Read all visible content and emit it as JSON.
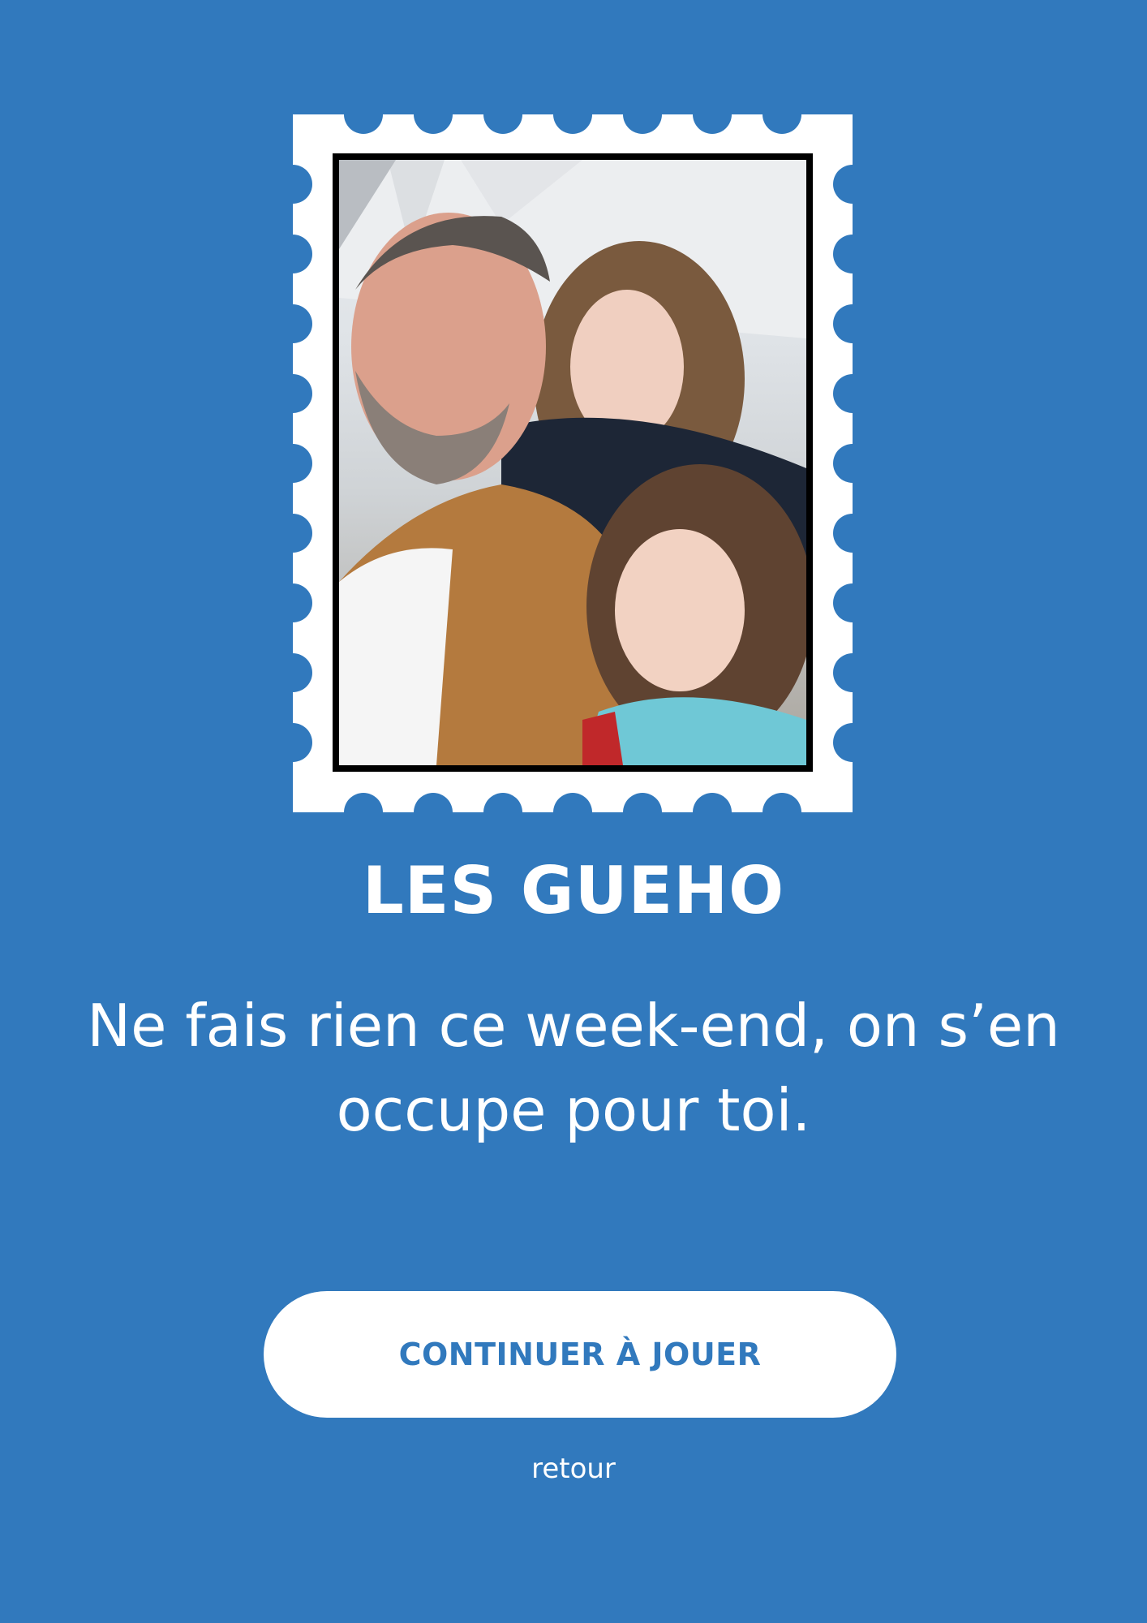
{
  "stamp": {
    "photo_alt": "family selfie",
    "frame_color": "#ffffff",
    "border_color": "#000000"
  },
  "title": "LES GUEHO",
  "message": "Ne fais rien ce week-end, on s’en occupe pour toi.",
  "buttons": {
    "continue_label": "CONTINUER À JOUER",
    "back_label": "retour"
  },
  "colors": {
    "background": "#3179bd",
    "button_bg": "#ffffff",
    "button_text": "#3179bd",
    "text": "#ffffff"
  }
}
